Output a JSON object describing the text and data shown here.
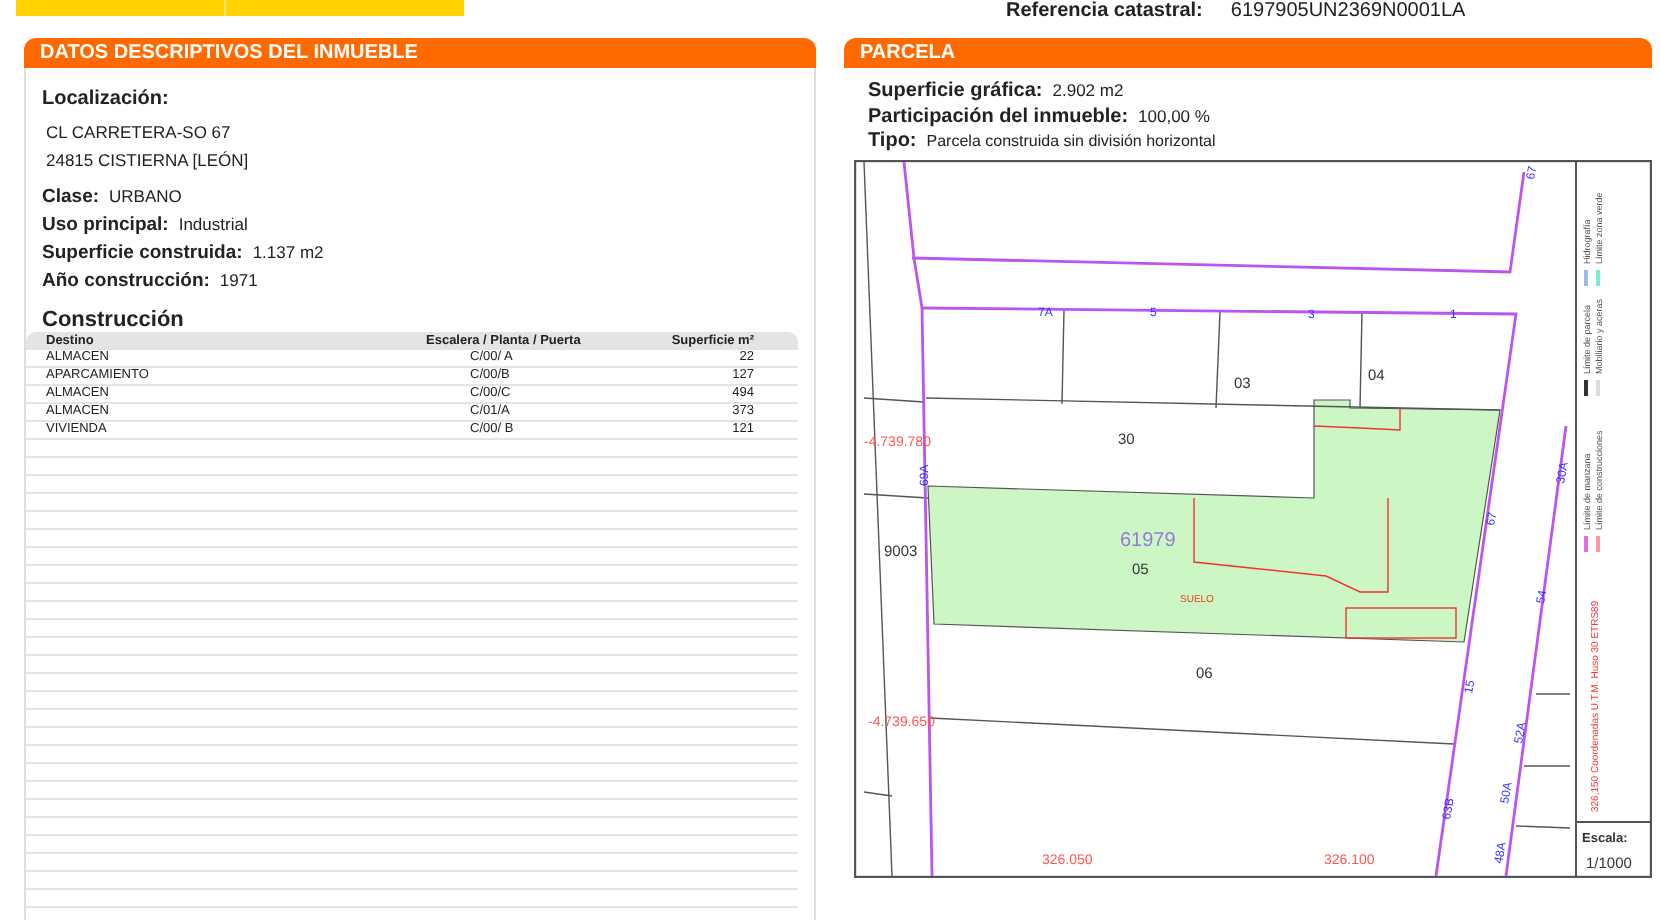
{
  "header": {
    "reference_label": "Referencia catastral:",
    "reference_value": "6197905UN2369N0001LA"
  },
  "inmueble": {
    "title": "DATOS DESCRIPTIVOS DEL INMUEBLE",
    "location_label": "Localización:",
    "address_lines": [
      "CL CARRETERA-SO 67",
      "24815 CISTIERNA [LEÓN]"
    ],
    "fields": [
      {
        "label": "Clase:",
        "value": "URBANO"
      },
      {
        "label": "Uso principal:",
        "value": "Industrial"
      },
      {
        "label": "Superficie construida:",
        "value": "1.137 m2"
      },
      {
        "label": "Año construcción:",
        "value": "1971"
      }
    ],
    "construction": {
      "title": "Construcción",
      "columns": [
        "Destino",
        "Escalera / Planta / Puerta",
        "Superficie m²"
      ],
      "rows": [
        [
          "ALMACEN",
          "C/00/ A",
          "22"
        ],
        [
          "APARCAMIENTO",
          "C/00/B",
          "127"
        ],
        [
          "ALMACEN",
          "C/00/C",
          "494"
        ],
        [
          "ALMACEN",
          "C/01/A",
          "373"
        ],
        [
          "VIVIENDA",
          "C/00/ B",
          "121"
        ]
      ]
    }
  },
  "parcela": {
    "title": "PARCELA",
    "fields": [
      {
        "label": "Superficie gráfica:",
        "value": "2.902 m2"
      },
      {
        "label": "Participación del inmueble:",
        "value": "100,00 %"
      },
      {
        "label": "Tipo:",
        "value": "Parcela construida sin división horizontal"
      }
    ],
    "map": {
      "labels": [
        {
          "text": "7A",
          "kind": "street_number"
        },
        {
          "text": "5",
          "kind": "street_number"
        },
        {
          "text": "3",
          "kind": "street_number"
        },
        {
          "text": "1",
          "kind": "street_number"
        },
        {
          "text": "67",
          "kind": "street_number"
        },
        {
          "text": "69A",
          "kind": "street_number"
        },
        {
          "text": "30A",
          "kind": "street_number"
        },
        {
          "text": "54",
          "kind": "street_number"
        },
        {
          "text": "67",
          "kind": "street_number"
        },
        {
          "text": "15",
          "kind": "street_number"
        },
        {
          "text": "52A",
          "kind": "street_number"
        },
        {
          "text": "50A",
          "kind": "street_number"
        },
        {
          "text": "63B",
          "kind": "street_number"
        },
        {
          "text": "48A",
          "kind": "street_number"
        },
        {
          "text": "03",
          "kind": "parcel_number"
        },
        {
          "text": "04",
          "kind": "parcel_number"
        },
        {
          "text": "30",
          "kind": "parcel_number"
        },
        {
          "text": "9003",
          "kind": "parcel_number"
        },
        {
          "text": "05",
          "kind": "parcel_number"
        },
        {
          "text": "06",
          "kind": "parcel_number"
        },
        {
          "text": "61979",
          "kind": "block_number"
        },
        {
          "text": "SUELO",
          "kind": "land_use"
        },
        {
          "text": "-4.739.780",
          "kind": "coordinate"
        },
        {
          "text": "-4.739.650",
          "kind": "coordinate"
        },
        {
          "text": "326.050",
          "kind": "coordinate"
        },
        {
          "text": "326.100",
          "kind": "coordinate"
        }
      ],
      "legend": [
        {
          "text": "Límite de manzana",
          "color": "#ee66ee"
        },
        {
          "text": "Límite de parcela",
          "color": "#333333"
        },
        {
          "text": "Hidrografía",
          "color": "#99bbee"
        },
        {
          "text": "Límite de construcciones",
          "color": "#ff9999"
        },
        {
          "text": "Mobiliario y aceras",
          "color": "#dddddd"
        },
        {
          "text": "Límite zona verde",
          "color": "#77eecc"
        }
      ],
      "coordinates_note": "326,150 Coordenadas U.T.M. Huso 30 ETRS89",
      "scale_label": "Escala:",
      "scale_value": "1/1000"
    }
  }
}
